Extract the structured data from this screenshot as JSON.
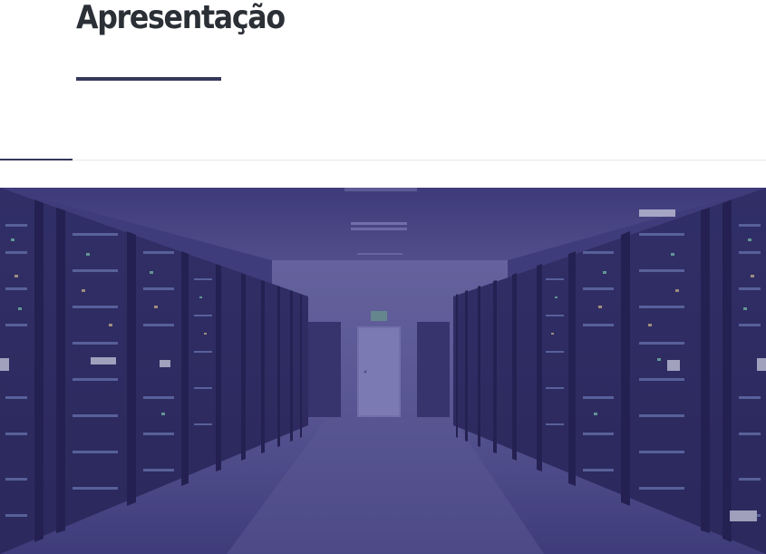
{
  "header": {
    "title": "Apresentação"
  },
  "hero": {
    "image": "server-room-photo",
    "overlay_color": "#3c3a78",
    "exit_sign": "exit-sign-icon"
  },
  "colors": {
    "title_text": "#2b2f36",
    "accent": "#35385a",
    "divider": "#e7e7ea"
  }
}
